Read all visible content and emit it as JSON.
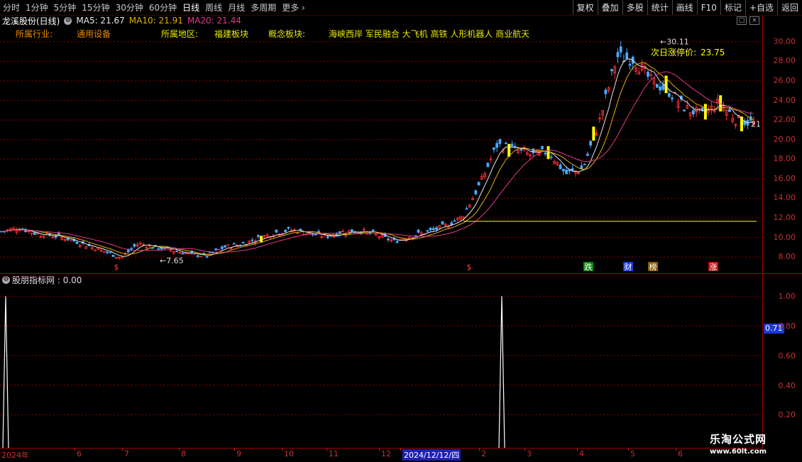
{
  "periods": [
    "分时",
    "1分钟",
    "5分钟",
    "15分钟",
    "30分钟",
    "60分钟",
    "日线",
    "周线",
    "月线",
    "多周期",
    "更多"
  ],
  "active_period": "日线",
  "toolbar": [
    "复权",
    "叠加",
    "多股",
    "统计",
    "画线",
    "F10",
    "标记",
    "+自选",
    "返回"
  ],
  "stock": {
    "name": "龙溪股份(日线)"
  },
  "ma": [
    {
      "label": "MA5: 21.67",
      "color": "#e8e8e8"
    },
    {
      "label": "MA10: 21.91",
      "color": "#e0b000"
    },
    {
      "label": "MA20: 21.44",
      "color": "#e03a8a"
    }
  ],
  "sectors": {
    "industry_label": "所属行业:",
    "industry": "通用设备",
    "region_label": "所属地区:",
    "region": "福建板块",
    "concept_label": "概念板块:",
    "concepts": "海峡西岸 军民融合 大飞机 高铁 人形机器人 商业航天"
  },
  "annotations": {
    "high": "30.11",
    "limit_label": "次日涨停价:",
    "limit_value": "23.75",
    "low": "7.65",
    "last": "21",
    "markers": [
      "$",
      "$",
      "跌",
      "财",
      "榜",
      "涨"
    ]
  },
  "price_axis": [
    "30.00",
    "28.00",
    "26.00",
    "24.00",
    "22.00",
    "20.00",
    "18.00",
    "16.00",
    "14.00",
    "12.00",
    "10.00",
    "8.00"
  ],
  "indicator": {
    "name": "股朋指标网",
    "value": "0.00"
  },
  "indicator_axis": [
    "1.00",
    "0.80",
    "0.60",
    "0.40",
    "0.20"
  ],
  "indicator_current": "0.71",
  "time_axis": [
    "2024年",
    "6",
    "7",
    "8",
    "9",
    "10",
    "11",
    "12",
    "2024/12/12/四",
    "2",
    "3",
    "4",
    "5",
    "6"
  ],
  "watermark": {
    "line1": "乐淘公式网",
    "line2": "www.60lt.com"
  },
  "colors": {
    "up": "#ff3030",
    "down": "#4aa8ff",
    "yellow": "#ffff00",
    "grid": "#8a0000"
  },
  "chart_data": {
    "type": "candlestick",
    "ylim": [
      7,
      31
    ],
    "x": [
      "2024年",
      "6",
      "7",
      "8",
      "9",
      "10",
      "11",
      "12",
      "2024/12/12/四",
      "2",
      "3",
      "4",
      "5",
      "6"
    ],
    "close_path": [
      10.6,
      11.0,
      10.4,
      10.2,
      9.8,
      9.2,
      8.6,
      7.9,
      9.4,
      9.0,
      8.7,
      8.3,
      8.1,
      9.0,
      9.3,
      9.9,
      10.5,
      10.8,
      10.4,
      10.1,
      10.6,
      10.7,
      10.2,
      9.6,
      10.2,
      10.6,
      11.2,
      12.2,
      15.5,
      19.5,
      19.0,
      18.4,
      18.8,
      16.5,
      17.0,
      22.0,
      28.5,
      28.2,
      26.0,
      25.0,
      23.2,
      22.5,
      23.8,
      22.0,
      21.7
    ],
    "ma5_last": 21.67,
    "ma10_last": 21.91,
    "ma20_last": 21.44,
    "high_annotation": 30.11,
    "low_annotation": 7.65,
    "limit_price": 23.75,
    "indicator_spikes": [
      {
        "x": "2024年",
        "value": 1.0
      },
      {
        "x": "2",
        "value": 1.0
      }
    ]
  }
}
